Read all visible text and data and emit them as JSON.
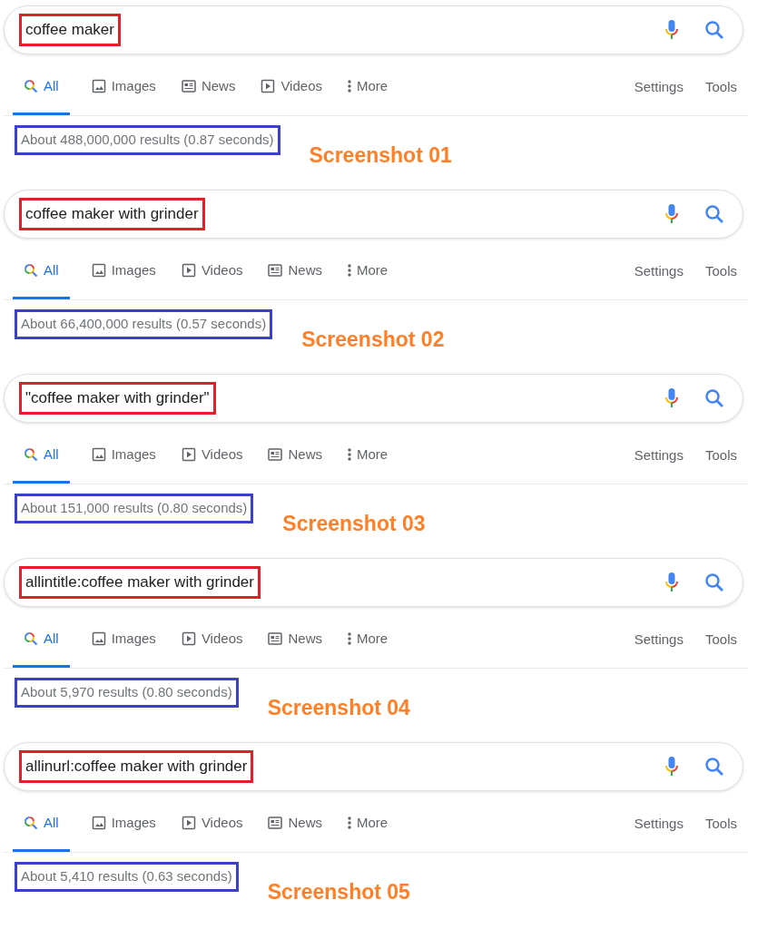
{
  "screenshots": [
    {
      "query": "coffee maker",
      "tabs": [
        {
          "kind": "all",
          "label": "All",
          "selected": true
        },
        {
          "kind": "images",
          "label": "Images",
          "selected": false
        },
        {
          "kind": "news",
          "label": "News",
          "selected": false
        },
        {
          "kind": "videos",
          "label": "Videos",
          "selected": false
        },
        {
          "kind": "more",
          "label": "More",
          "selected": false
        }
      ],
      "settings": "Settings",
      "tools": "Tools",
      "results": "About 488,000,000 results (0.87 seconds)",
      "caption": "Screenshot 01"
    },
    {
      "query": "coffee maker with grinder",
      "tabs": [
        {
          "kind": "all",
          "label": "All",
          "selected": true
        },
        {
          "kind": "images",
          "label": "Images",
          "selected": false
        },
        {
          "kind": "videos",
          "label": "Videos",
          "selected": false
        },
        {
          "kind": "news",
          "label": "News",
          "selected": false
        },
        {
          "kind": "more",
          "label": "More",
          "selected": false
        }
      ],
      "settings": "Settings",
      "tools": "Tools",
      "results": "About 66,400,000 results (0.57 seconds)",
      "caption": "Screenshot 02"
    },
    {
      "query": "\"coffee maker with grinder\"",
      "tabs": [
        {
          "kind": "all",
          "label": "All",
          "selected": true
        },
        {
          "kind": "images",
          "label": "Images",
          "selected": false
        },
        {
          "kind": "videos",
          "label": "Videos",
          "selected": false
        },
        {
          "kind": "news",
          "label": "News",
          "selected": false
        },
        {
          "kind": "more",
          "label": "More",
          "selected": false
        }
      ],
      "settings": "Settings",
      "tools": "Tools",
      "results": "About 151,000 results (0.80 seconds)",
      "caption": "Screenshot 03"
    },
    {
      "query": "allintitle:coffee maker with grinder",
      "tabs": [
        {
          "kind": "all",
          "label": "All",
          "selected": true
        },
        {
          "kind": "images",
          "label": "Images",
          "selected": false
        },
        {
          "kind": "videos",
          "label": "Videos",
          "selected": false
        },
        {
          "kind": "news",
          "label": "News",
          "selected": false
        },
        {
          "kind": "more",
          "label": "More",
          "selected": false
        }
      ],
      "settings": "Settings",
      "tools": "Tools",
      "results": "About 5,970 results (0.80 seconds)",
      "caption": "Screenshot 04"
    },
    {
      "query": "allinurl:coffee maker with grinder",
      "tabs": [
        {
          "kind": "all",
          "label": "All",
          "selected": true
        },
        {
          "kind": "images",
          "label": "Images",
          "selected": false
        },
        {
          "kind": "videos",
          "label": "Videos",
          "selected": false
        },
        {
          "kind": "news",
          "label": "News",
          "selected": false
        },
        {
          "kind": "more",
          "label": "More",
          "selected": false
        }
      ],
      "settings": "Settings",
      "tools": "Tools",
      "results": "About 5,410 results (0.63 seconds)",
      "caption": "Screenshot 05"
    }
  ]
}
